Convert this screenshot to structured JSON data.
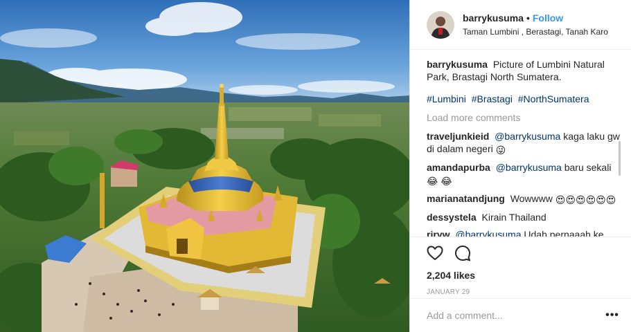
{
  "post": {
    "username": "barrykusuma",
    "separator": "•",
    "follow_label": "Follow",
    "location": "Taman Lumbini , Berastagi, Tanah Karo"
  },
  "caption": {
    "username": "barrykusuma",
    "text": "Picture of Lumbini Natural Park, Brastagi North Sumatera.",
    "hashtags": [
      "#Lumbini",
      "#Brastagi",
      "#NorthSumatera"
    ]
  },
  "load_more_label": "Load more comments",
  "comments": [
    {
      "user": "traveljunkieid",
      "mention": "@barrykusuma",
      "text": "kaga laku gw di dalam negeri",
      "emoji": "😜"
    },
    {
      "user": "amandapurba",
      "mention": "@barrykusuma",
      "text": "baru sekali",
      "emoji": "😂 😂"
    },
    {
      "user": "marianatandjung",
      "mention": "",
      "text": "Wowwww",
      "emoji": "😍😍😍😍😍😍"
    },
    {
      "user": "dessystela",
      "mention": "",
      "text": "Kirain Thailand",
      "emoji": ""
    },
    {
      "user": "riryw",
      "mention": "@barrykusuma",
      "text": "Udah pernaaah ke",
      "emoji": ""
    }
  ],
  "actions": {
    "like_icon": "heart-icon",
    "comment_icon": "comment-bubble-icon",
    "likes_label": "2,204 likes",
    "date_label": "JANUARY 29"
  },
  "add_comment": {
    "placeholder": "Add a comment...",
    "more_label": "•••"
  },
  "colors": {
    "link_blue": "#3897f0",
    "hashtag_blue": "#003569",
    "muted_gray": "#999999",
    "divider": "#efefef"
  }
}
